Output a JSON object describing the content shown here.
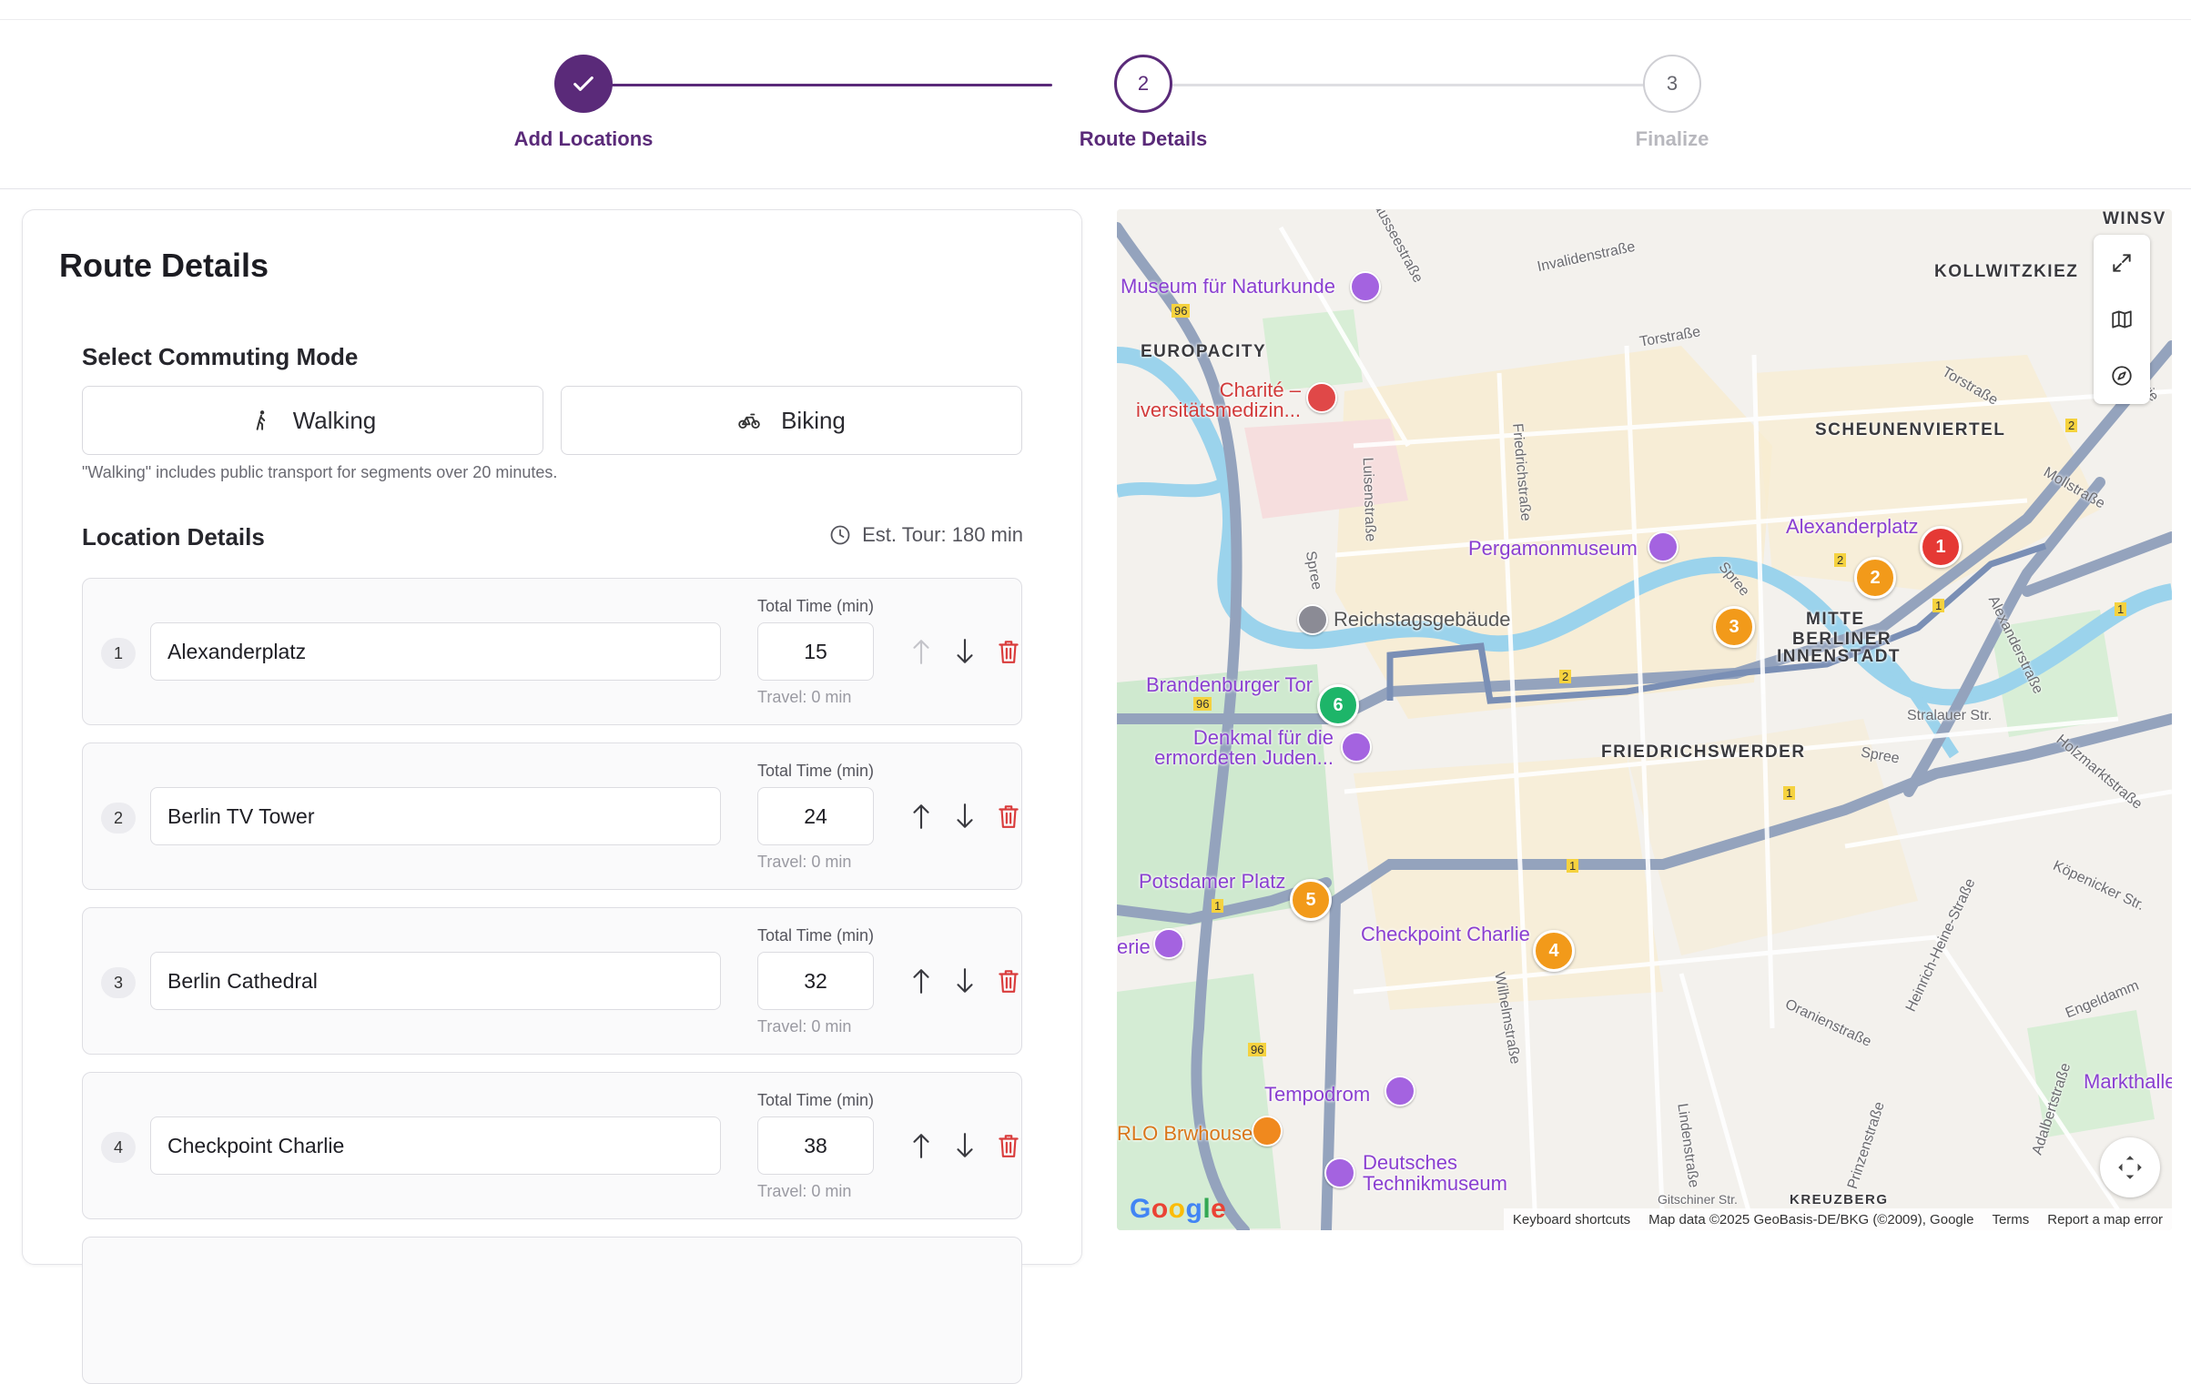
{
  "stepper": {
    "steps": [
      {
        "label": "Add Locations",
        "number": "1",
        "state": "completed"
      },
      {
        "label": "Route Details",
        "number": "2",
        "state": "active"
      },
      {
        "label": "Finalize",
        "number": "3",
        "state": "pending"
      }
    ]
  },
  "colors": {
    "brand": "#5a2a79",
    "pending": "#b8b8be",
    "delete": "#d93b3b",
    "marker_red": "#e53935",
    "marker_orange": "#f29a1a",
    "marker_green": "#1db569"
  },
  "panel": {
    "title": "Route Details",
    "commute": {
      "section_title": "Select Commuting Mode",
      "walking_label": "Walking",
      "biking_label": "Biking",
      "hint": "\"Walking\" includes public transport for segments over 20 minutes."
    },
    "locations": {
      "section_title": "Location Details",
      "estimate": "Est. Tour: 180 min",
      "time_label": "Total Time (min)",
      "items": [
        {
          "index": "1",
          "name": "Alexanderplatz",
          "time": "15",
          "travel": "Travel: 0 min"
        },
        {
          "index": "2",
          "name": "Berlin TV Tower",
          "time": "24",
          "travel": "Travel: 0 min"
        },
        {
          "index": "3",
          "name": "Berlin Cathedral",
          "time": "32",
          "travel": "Travel: 0 min"
        },
        {
          "index": "4",
          "name": "Checkpoint Charlie",
          "time": "38",
          "travel": "Travel: 0 min"
        }
      ]
    }
  },
  "map": {
    "markers": [
      "1",
      "2",
      "3",
      "4",
      "5",
      "6"
    ],
    "pois": {
      "museum_naturkunde": "Museum für Naturkunde",
      "charite": "Charité –\niversitätsmedizin...",
      "pergamon": "Pergamonmuseum",
      "alexanderplatz": "Alexanderplatz",
      "reichstag": "Reichstagsgebäude",
      "brandenburger": "Brandenburger Tor",
      "denkmal": "Denkmal für die\nermordeten Juden...",
      "potsdamer": "Potsdamer Platz",
      "checkpoint": "Checkpoint Charlie",
      "tempodrom": "Tempodrom",
      "brwhouse": "RLO Brwhouse",
      "technikmuseum": "Deutsches\nTechnikmuseum",
      "erie": "erie",
      "markthalle": "Markthalle"
    },
    "areas": {
      "europacity": "EUROPACITY",
      "kollwitz": "KOLLWITZKIEZ",
      "scheunen": "SCHEUNENVIERTEL",
      "mitte": "MITTE",
      "berliner1": "BERLINER",
      "berliner2": "INNENSTADT",
      "friedrichswerder": "FRIEDRICHSWERDER",
      "kreuzberg": "KREUZBERG",
      "winsv": "WINSV"
    },
    "streets": {
      "invaliden": "Invalidenstraße",
      "torstr": "Torstraße",
      "torstr2": "Torstraße",
      "mollstr": "Mollstraße",
      "friedrich": "Friedrichstraße",
      "luisen": "Luisenstraße",
      "spree1": "Spree",
      "spree2": "Spree",
      "spree3": "Spree",
      "alexander": "Alexanderstraße",
      "stralauer": "Stralauer Str.",
      "holzmarkt": "Holzmarktstraße",
      "koepenicker": "Köpenicker Str.",
      "engeldamm": "Engeldamm",
      "heinrich": "Heinrich-Heine-Straße",
      "oranien": "Oranienstraße",
      "prinzen": "Prinzenstraße",
      "adalbert": "Adalbertstraße",
      "wilhelm": "Wilhelmstraße",
      "linden": "Lindenstraße",
      "gitschiner": "Gitschiner Str.",
      "chaussee": "ausseestraße",
      "fri": "Frie"
    },
    "road_numbers": {
      "r96a": "96",
      "r96b": "96",
      "r96c": "96",
      "r2a": "2",
      "r2b": "2",
      "r2c": "2",
      "r1a": "1",
      "r1b": "1",
      "r1c": "1",
      "r1d": "1",
      "r1e": "1"
    },
    "footer": {
      "keyboard": "Keyboard shortcuts",
      "mapdata": "Map data ©2025 GeoBasis-DE/BKG (©2009), Google",
      "terms": "Terms",
      "report": "Report a map error"
    },
    "google": "Google"
  }
}
